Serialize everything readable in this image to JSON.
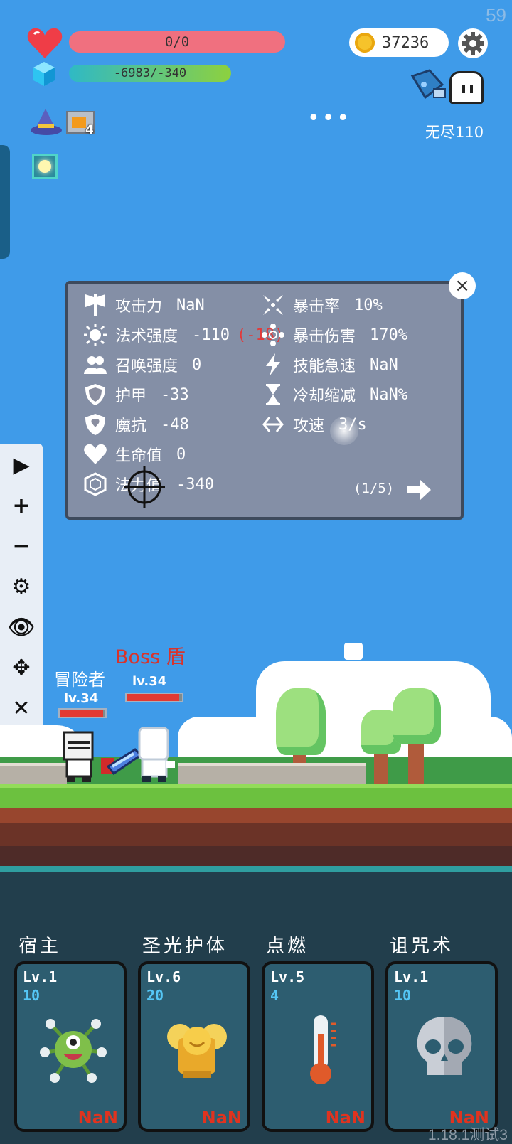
{
  "fps": "59",
  "hud": {
    "hp_text": "0/0",
    "mp_text": "-6983/-340",
    "coins": "37236",
    "mode_label": "无尽110",
    "menu_dots": "•••",
    "bag_count": "4",
    "icons": [
      "heart-icon",
      "gem-icon",
      "coin-icon",
      "gear-icon",
      "wizard-hat-icon",
      "bag-icon",
      "buff-icon",
      "ghost-icon"
    ]
  },
  "stats": {
    "left": [
      {
        "icon": "axe-icon",
        "label": "攻击力",
        "value": "NaN"
      },
      {
        "icon": "sun-icon",
        "label": "法术强度",
        "value": "-110",
        "extra": "(-18)"
      },
      {
        "icon": "summon-icon",
        "label": "召唤强度",
        "value": "0"
      },
      {
        "icon": "shield-icon",
        "label": "护甲",
        "value": "-33"
      },
      {
        "icon": "magic-shield-icon",
        "label": "魔抗",
        "value": "-48"
      },
      {
        "icon": "heart-icon",
        "label": "生命值",
        "value": "0"
      },
      {
        "icon": "mana-gem-icon",
        "label": "法力值",
        "value": "-340"
      }
    ],
    "right": [
      {
        "icon": "crit-icon",
        "label": "暴击率",
        "value": "10%"
      },
      {
        "icon": "crit-damage-icon",
        "label": "暴击伤害",
        "value": "170%"
      },
      {
        "icon": "lightning-icon",
        "label": "技能急速",
        "value": "NaN"
      },
      {
        "icon": "hourglass-icon",
        "label": "冷却缩减",
        "value": "NaN%"
      },
      {
        "icon": "attack-speed-icon",
        "label": "攻速",
        "value": "3/s"
      }
    ],
    "page": "(1/5)",
    "close": "×"
  },
  "toolbar": [
    "▶",
    "+",
    "−",
    "⚙",
    "👁",
    "✥",
    "✕"
  ],
  "battle": {
    "boss_title": "Boss 盾",
    "hero_name": "冒险者",
    "hero_level": "lv.34",
    "boss_level": "lv.34",
    "hero_hp_fraction": 0.95,
    "boss_hp_fraction": 0.95
  },
  "skills": [
    {
      "name": "宿主",
      "level": "Lv.1",
      "value": "10",
      "cost": "NaN",
      "icon": "virus-monster-icon"
    },
    {
      "name": "圣光护体",
      "level": "Lv.6",
      "value": "20",
      "cost": "NaN",
      "icon": "holy-armor-icon"
    },
    {
      "name": "点燃",
      "level": "Lv.5",
      "value": "4",
      "cost": "NaN",
      "icon": "thermometer-icon"
    },
    {
      "name": "诅咒术",
      "level": "Lv.1",
      "value": "10",
      "cost": "NaN",
      "icon": "skull-icon"
    }
  ],
  "version": "1.18.1测试3"
}
